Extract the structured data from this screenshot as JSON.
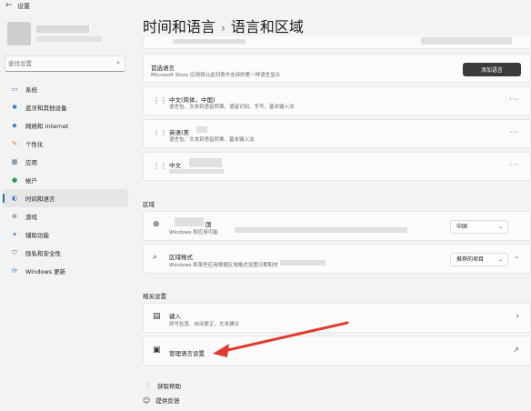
{
  "titlebar": {
    "back_icon": "back-arrow-icon",
    "app_title": "设置"
  },
  "search": {
    "placeholder": "查找设置",
    "value": "查找设置"
  },
  "sidebar": {
    "items": [
      {
        "label": "系统",
        "icon": "monitor-icon",
        "color": "#2b78c2",
        "active": false
      },
      {
        "label": "蓝牙和其他设备",
        "icon": "bluetooth-icon",
        "color": "#1a6fb8",
        "active": false
      },
      {
        "label": "网络和 Internet",
        "icon": "wifi-icon",
        "color": "#3a7fc4",
        "active": false
      },
      {
        "label": "个性化",
        "icon": "pencil-icon",
        "color": "#d9782a",
        "active": false
      },
      {
        "label": "应用",
        "icon": "apps-icon",
        "color": "#4a6a8a",
        "active": false
      },
      {
        "label": "帐户",
        "icon": "account-icon",
        "color": "#2e9c5a",
        "active": false
      },
      {
        "label": "时间和语言",
        "icon": "globe-clock-icon",
        "color": "#2b78c2",
        "active": true
      },
      {
        "label": "游戏",
        "icon": "gamepad-icon",
        "color": "#666666",
        "active": false
      },
      {
        "label": "辅助功能",
        "icon": "accessibility-icon",
        "color": "#2b78c2",
        "active": false
      },
      {
        "label": "隐私和安全性",
        "icon": "shield-icon",
        "color": "#666666",
        "active": false
      },
      {
        "label": "Windows 更新",
        "icon": "update-icon",
        "color": "#2b78c2",
        "active": false
      }
    ]
  },
  "header": {
    "parent": "时间和语言",
    "separator": "›",
    "title": "语言和区域"
  },
  "preferred_language": {
    "title": "首选语言",
    "subtitle": "Microsoft Store 应用将以此列表中支持的第一种语言显示",
    "add_button": "添加语言"
  },
  "languages": [
    {
      "title": "中文(简体，中国)",
      "subtitle": "语言包、文本到语音转换、语音识别、手写、基本输入法"
    },
    {
      "title": "英语(美",
      "subtitle": "语言包、文本到语音转换、基本输入法"
    },
    {
      "title": "中文",
      "subtitle": ""
    }
  ],
  "region": {
    "section_label": "区域",
    "country": {
      "title": "国",
      "subtitle": "Windows 和应用可能",
      "value": "中国"
    },
    "format": {
      "title": "区域格式",
      "subtitle": "Windows 和某些应用根据区域格式设置日期和时",
      "value": "推荐的项目"
    }
  },
  "related": {
    "section_label": "相关设置",
    "typing": {
      "title": "键入",
      "subtitle": "拼写检查、自动更正、文本建议"
    },
    "admin": {
      "title": "管理语言设置"
    }
  },
  "footer": {
    "help": "获取帮助",
    "feedback": "提供反馈"
  },
  "annotation": {
    "arrow_color": "#e23b2e"
  }
}
